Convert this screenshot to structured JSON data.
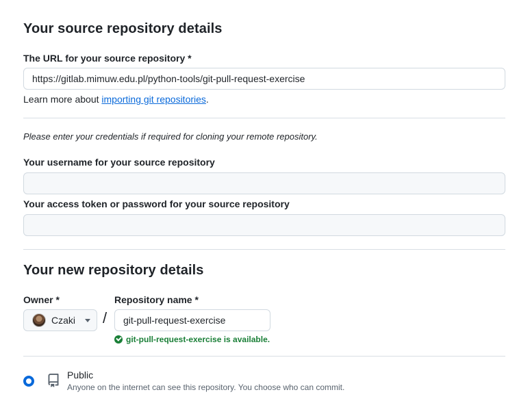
{
  "source": {
    "heading": "Your source repository details",
    "url_label": "The URL for your source repository *",
    "url_value": "https://gitlab.mimuw.edu.pl/python-tools/git-pull-request-exercise",
    "learn_prefix": "Learn more about ",
    "learn_link": "importing git repositories",
    "learn_suffix": "."
  },
  "credentials": {
    "note": "Please enter your credentials if required for cloning your remote repository.",
    "username_label": "Your username for your source repository",
    "username_value": "",
    "token_label": "Your access token or password for your source repository",
    "token_value": ""
  },
  "new_repo": {
    "heading": "Your new repository details",
    "owner_label": "Owner *",
    "owner_name": "Czaki",
    "slash": "/",
    "name_label": "Repository name *",
    "name_value": "git-pull-request-exercise",
    "availability": "git-pull-request-exercise is available."
  },
  "visibility": {
    "public_title": "Public",
    "public_desc": "Anyone on the internet can see this repository. You choose who can commit."
  },
  "colors": {
    "accent": "#0969da",
    "success": "#1a7f37"
  }
}
